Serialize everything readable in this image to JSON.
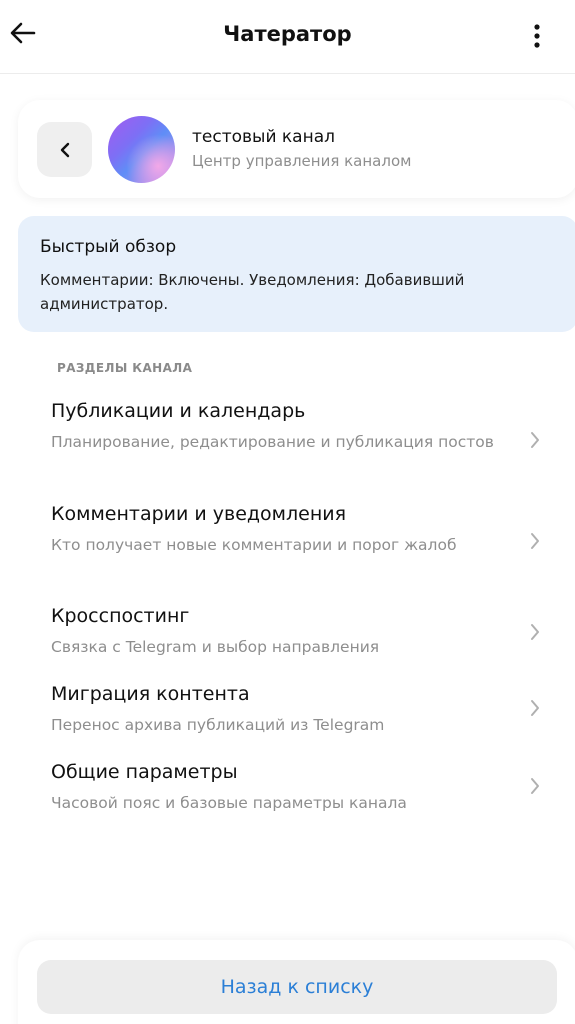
{
  "header": {
    "title": "Чатератор",
    "back_icon": "arrow-left-icon",
    "more_icon": "more-vertical-icon"
  },
  "channel": {
    "name": "тестовый канал",
    "subtitle": "Центр управления каналом",
    "back_icon": "chevron-left-icon"
  },
  "overview": {
    "title": "Быстрый обзор",
    "text": "Комментарии: Включены. Уведомления: Добавивший администратор."
  },
  "sections": {
    "caption": "РАЗДЕЛЫ КАНАЛА",
    "items": [
      {
        "title": "Публикации и календарь",
        "desc": "Планирование, редактирование и публикация постов"
      },
      {
        "title": "Комментарии и уведомления",
        "desc": "Кто получает новые комментарии и порог жалоб"
      },
      {
        "title": "Кросспостинг",
        "desc": "Связка с Telegram и выбор направления"
      },
      {
        "title": "Миграция контента",
        "desc": "Перенос архива публикаций из Telegram"
      },
      {
        "title": "Общие параметры",
        "desc": "Часовой пояс и базовые параметры канала"
      }
    ]
  },
  "footer": {
    "back_to_list": "Назад к списку"
  },
  "colors": {
    "accent": "#2b7fd6",
    "overview_bg": "#e7f0fb"
  }
}
